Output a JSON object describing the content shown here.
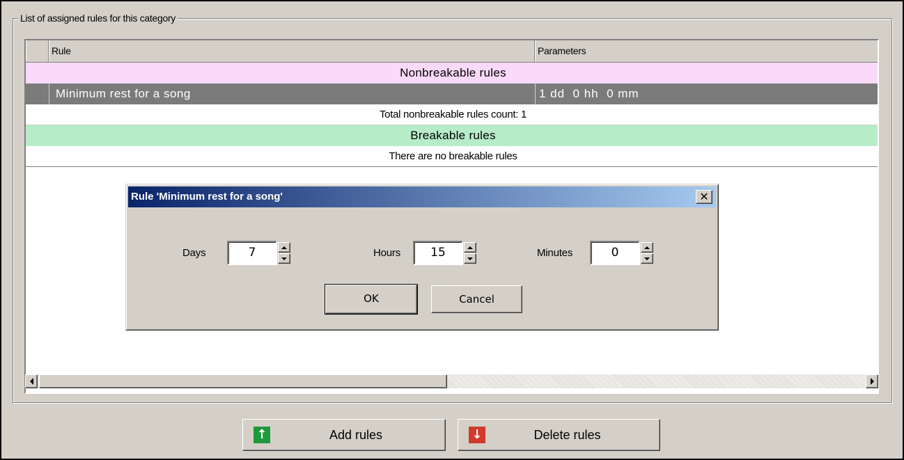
{
  "groupbox": {
    "legend": "List of assigned rules for this category"
  },
  "grid": {
    "columns": [
      "Rule",
      "Parameters"
    ],
    "sections": {
      "nonbreakable_header": "Nonbreakable rules",
      "selected_row": {
        "rule": "Minimum rest for a song",
        "parameters": "1 dd  0 hh  0 mm"
      },
      "nonbreakable_total": "Total nonbreakable rules count: 1",
      "breakable_header": "Breakable rules",
      "breakable_empty": "There are no breakable rules"
    }
  },
  "dialog": {
    "title": "Rule 'Minimum rest for a song'",
    "close_glyph": "✕",
    "fields": {
      "days": {
        "label": "Days",
        "value": "7"
      },
      "hours": {
        "label": "Hours",
        "value": "15"
      },
      "minutes": {
        "label": "Minutes",
        "value": "0"
      }
    },
    "ok_label": "OK",
    "cancel_label": "Cancel"
  },
  "actions": {
    "add_label": "Add rules",
    "delete_label": "Delete rules",
    "add_icon": "arrow-up-icon",
    "delete_icon": "arrow-down-icon",
    "add_color": "#1e9a3c",
    "delete_color": "#d23a2a"
  }
}
